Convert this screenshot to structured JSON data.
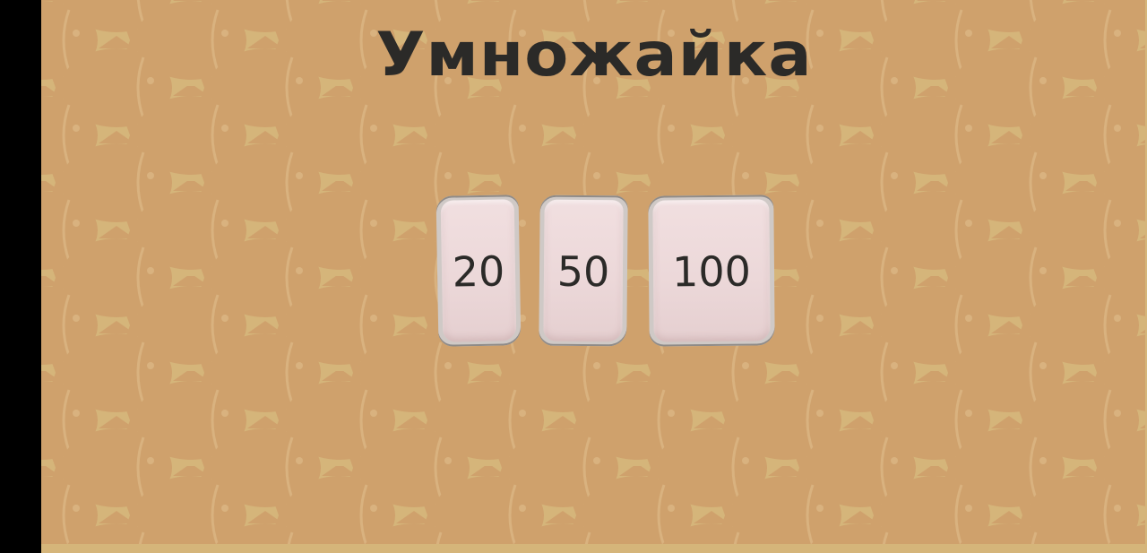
{
  "app": {
    "title": "Умножайка"
  },
  "options": [
    {
      "label": "20"
    },
    {
      "label": "50"
    },
    {
      "label": "100"
    }
  ],
  "colors": {
    "background": "#d5b57a",
    "fish_pattern": "#cfa16c",
    "tile_face": "#ecd8d9",
    "tile_border": "#8f8b88",
    "text": "#2b2a28"
  },
  "background_icon": "fish-icon"
}
